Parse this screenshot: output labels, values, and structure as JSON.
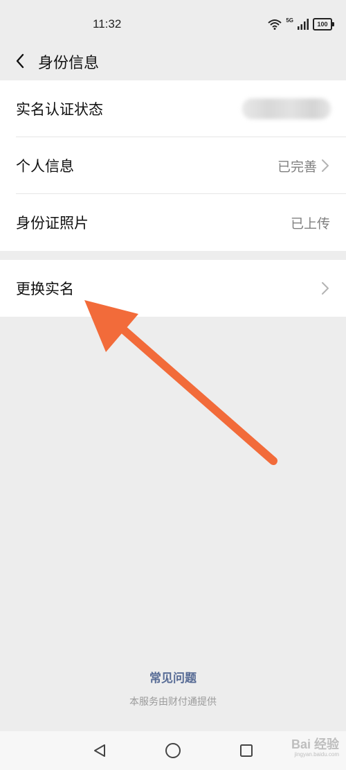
{
  "status_bar": {
    "time": "11:32",
    "network": "5G",
    "battery": "100"
  },
  "nav": {
    "title": "身份信息"
  },
  "identity_group": {
    "rows": [
      {
        "label": "实名认证状态",
        "value": ""
      },
      {
        "label": "个人信息",
        "value": "已完善"
      },
      {
        "label": "身份证照片",
        "value": "已上传"
      }
    ]
  },
  "change_group": {
    "label": "更换实名"
  },
  "footer": {
    "faq": "常见问题",
    "provider": "本服务由财付通提供"
  },
  "watermark": {
    "text": "Bai 经验",
    "sub": "jingyan.baidu.com"
  },
  "colors": {
    "background": "#ededed",
    "link": "#576b95",
    "annotation_arrow": "#f26b3a"
  }
}
